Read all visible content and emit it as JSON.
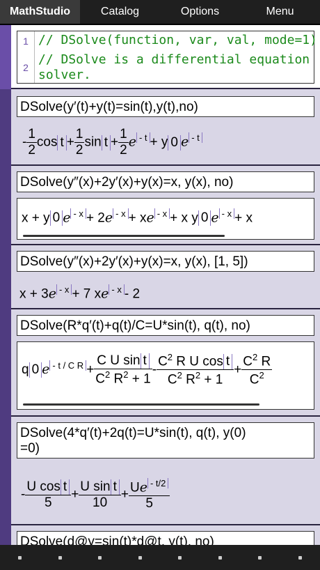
{
  "tabs": [
    {
      "label": "MathStudio",
      "active": true
    },
    {
      "label": "Catalog",
      "active": false
    },
    {
      "label": "Options",
      "active": false
    },
    {
      "label": "Menu",
      "active": false
    }
  ],
  "editor": {
    "lines": [
      {
        "num": "1",
        "text": "// DSolve(function, var, val, mode=1)"
      },
      {
        "num": "2",
        "text": "// DSolve is a differential equation"
      },
      {
        "num": "",
        "text": "solver."
      }
    ]
  },
  "entries": [
    {
      "input": "DSolve(y′(t)+y(t)=sin(t),y(t),no)"
    },
    {
      "input": "DSolve(y″(x)+2y′(x)+y(x)=x, y(x), no)"
    },
    {
      "input": "DSolve(y″(x)+2y′(x)+y(x)=x, y(x), [1, 5])"
    },
    {
      "input": "DSolve(R*q′(t)+q(t)/C=U*sin(t), q(t), no)"
    },
    {
      "input": "DSolve(4*q′(t)+2q(t)=U*sin(t), q(t), y(0)",
      "input2": "=0)"
    },
    {
      "input": "DSolve(d@y=sin(t)*d@t, y(t), no)"
    }
  ],
  "bottom_dots": 8,
  "colors": {
    "accent": "#6a4ea8",
    "code": "#1b8a1b",
    "bar": "#1f1f1f"
  }
}
